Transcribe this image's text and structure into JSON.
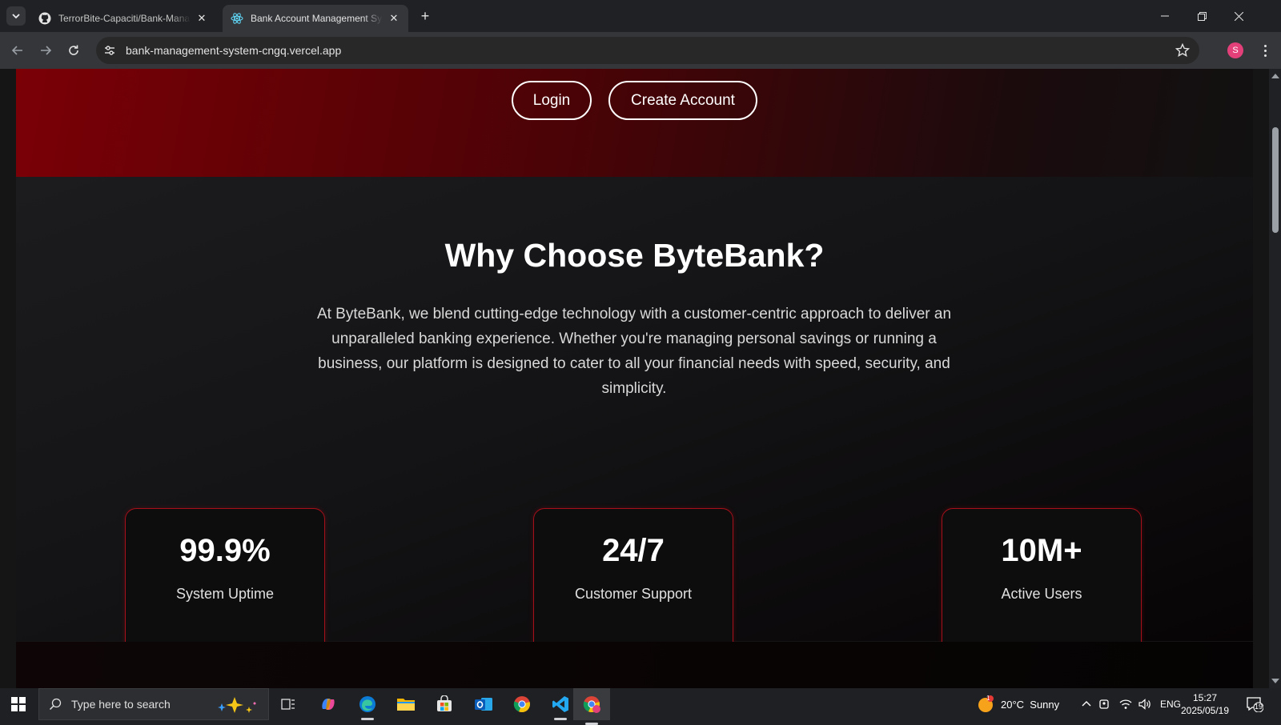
{
  "browser": {
    "tabs": [
      {
        "title": "TerrorBite-Capaciti/Bank-Management-System",
        "icon": "github-icon",
        "active": false
      },
      {
        "title": "Bank Account Management System",
        "icon": "react-icon",
        "active": true
      }
    ],
    "url": "bank-management-system-cngq.vercel.app",
    "profile_initial": "S"
  },
  "hero": {
    "login_label": "Login",
    "create_label": "Create Account"
  },
  "why": {
    "title": "Why Choose ByteBank?",
    "description": "At ByteBank, we blend cutting-edge technology with a customer-centric approach to deliver an unparalleled banking experience. Whether you're managing personal savings or running a business, our platform is designed to cater to all your financial needs with speed, security, and simplicity.",
    "stats": [
      {
        "value": "99.9%",
        "label": "System Uptime"
      },
      {
        "value": "24/7",
        "label": "Customer Support"
      },
      {
        "value": "10M+",
        "label": "Active Users"
      }
    ]
  },
  "taskbar": {
    "search_placeholder": "Type here to search",
    "weather": "20°C  Sunny",
    "weather_badge": "1",
    "language": "ENG",
    "time": "15:27",
    "date": "2025/05/19",
    "notifications": "19"
  },
  "colors": {
    "accent_red": "#a5101a",
    "hero_red": "#7a0006"
  }
}
